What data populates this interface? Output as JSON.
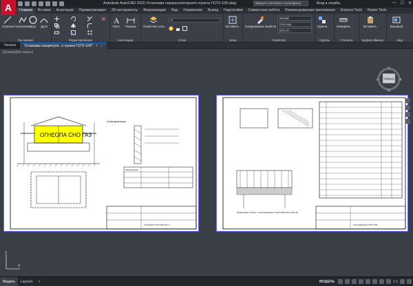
{
  "app": {
    "logo": "A",
    "title": "Autodesk AutoCAD 2020   Установка газорегуляторного пункта ГСГО-100.dwg",
    "search_placeholder": "Введите ключевое слово/фразу",
    "signin": "Вход в службы"
  },
  "ribbon_tabs": [
    "Главная",
    "Вставка",
    "Аннотации",
    "Параметризация",
    "3D-инструменты",
    "Визуализация",
    "Вид",
    "Управление",
    "Вывод",
    "Надстройки",
    "Совместная работа",
    "Рекомендованные приложения",
    "Express Tools",
    "Raster Tools"
  ],
  "ribbon": {
    "draw": {
      "label": "Рисование",
      "buttons": [
        "Отрезок",
        "Полилиния",
        "Круг",
        "Дуга"
      ]
    },
    "modify": {
      "label": "Редактирование"
    },
    "annotation": {
      "label": "Аннотации",
      "buttons": [
        "Текст",
        "Размер"
      ]
    },
    "layers": {
      "label": "Слои",
      "button": "Свойства слоя",
      "combo": "0"
    },
    "block": {
      "label": "Блок",
      "button": "Вставить"
    },
    "properties": {
      "label": "Свойства",
      "button": "Копирование свойств",
      "color": "Белый",
      "linetype": "ПоСлою",
      "lineweight": "BYLAY..."
    },
    "groups": {
      "label": "Группы",
      "button": "Группа"
    },
    "utilities": {
      "label": "Утилиты",
      "button": "Измерить"
    },
    "clipboard": {
      "label": "Буфер обмена",
      "button": "Вставить"
    },
    "view": {
      "label": "Вид",
      "button": "Базовый"
    }
  },
  "doc_tabs": {
    "start": "Начало",
    "active": "Установка газорегуля...о пункта ГСГО-100*"
  },
  "viewport": {
    "label": "[-][Сверху][2D-каркас]",
    "viewcube": {
      "face": "Сверху",
      "north": "С",
      "south": "Ю",
      "west": "З",
      "east": "В",
      "wcs": "МСК"
    },
    "sheet1": {
      "yellow_box_text": "ОГНЕОПА СНО ГАЗ",
      "side_title": "Скоба крепления",
      "table_col1": "Обозначение",
      "stamp_text": "Установка ГСГО-100 лист 1"
    },
    "sheet2": {
      "note_text": "Примечание: Опоры - электросварные ГОСТ 10704-91 сталь 20",
      "stamp_text": "Спецификация ГСГО-100"
    }
  },
  "status_bar": {
    "tabs": [
      "Модель",
      "Layout1"
    ],
    "model_label": "МОДЕЛЬ",
    "scale": "1:1"
  },
  "colors": {
    "accent": "#2f7ad8",
    "logo": "#c8102e",
    "highlight": "#ffff00",
    "sheet_border": "#6a6aff"
  }
}
